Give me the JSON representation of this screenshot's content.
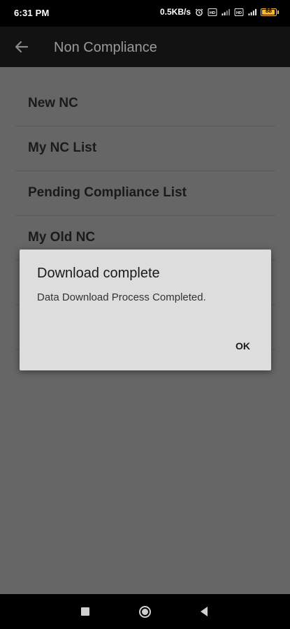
{
  "status_bar": {
    "time": "6:31 PM",
    "network_speed": "0.5KB/s",
    "battery_level": "88",
    "icons": [
      "alarm-icon",
      "volte-icon",
      "signal-icon",
      "volte-icon",
      "signal-icon",
      "battery-icon"
    ],
    "battery_color": "#f5b82e"
  },
  "app_bar": {
    "title": "Non Compliance",
    "back_icon": "back-arrow-icon"
  },
  "menu": {
    "items": [
      {
        "label": "New NC"
      },
      {
        "label": "My NC List"
      },
      {
        "label": "Pending Compliance List"
      },
      {
        "label": "My Old NC"
      }
    ]
  },
  "dialog": {
    "title": "Download complete",
    "message": "Data Download Process Completed.",
    "ok_label": "OK"
  },
  "nav_bar": {
    "icons": [
      "recents-icon",
      "home-icon",
      "back-icon"
    ]
  }
}
